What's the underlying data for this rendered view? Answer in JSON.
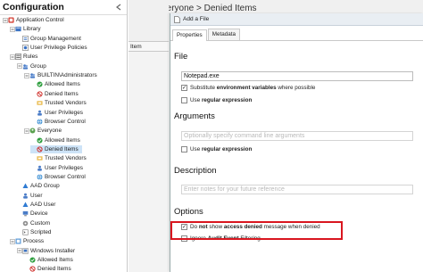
{
  "left_panel": {
    "title": "Configuration",
    "tree": [
      {
        "label": "Application Control",
        "icon": "appcontrol-icon",
        "indent": 0,
        "expander": "minus"
      },
      {
        "label": "Library",
        "icon": "library-icon",
        "indent": 1,
        "expander": "minus"
      },
      {
        "label": "Group Management",
        "icon": "group-mgmt-icon",
        "indent": 2,
        "expander": ""
      },
      {
        "label": "User Privilege Policies",
        "icon": "policy-icon",
        "indent": 2,
        "expander": ""
      },
      {
        "label": "Rules",
        "icon": "rules-icon",
        "indent": 1,
        "expander": "minus"
      },
      {
        "label": "Group",
        "icon": "group-icon",
        "indent": 2,
        "expander": "minus"
      },
      {
        "label": "BUILTIN\\Administrators",
        "icon": "users-icon",
        "indent": 3,
        "expander": "minus"
      },
      {
        "label": "Allowed Items",
        "icon": "allowed-icon",
        "indent": 4,
        "expander": ""
      },
      {
        "label": "Denied Items",
        "icon": "denied-icon",
        "indent": 4,
        "expander": ""
      },
      {
        "label": "Trusted Vendors",
        "icon": "vendor-icon",
        "indent": 4,
        "expander": ""
      },
      {
        "label": "User Privileges",
        "icon": "privileges-icon",
        "indent": 4,
        "expander": ""
      },
      {
        "label": "Browser Control",
        "icon": "browser-icon",
        "indent": 4,
        "expander": ""
      },
      {
        "label": "Everyone",
        "icon": "everyone-icon",
        "indent": 3,
        "expander": "minus"
      },
      {
        "label": "Allowed Items",
        "icon": "allowed-icon",
        "indent": 4,
        "expander": ""
      },
      {
        "label": "Denied Items",
        "icon": "denied-icon",
        "indent": 4,
        "expander": "",
        "selected": true
      },
      {
        "label": "Trusted Vendors",
        "icon": "vendor-icon",
        "indent": 4,
        "expander": ""
      },
      {
        "label": "User Privileges",
        "icon": "privileges-icon",
        "indent": 4,
        "expander": ""
      },
      {
        "label": "Browser Control",
        "icon": "browser-icon",
        "indent": 4,
        "expander": ""
      },
      {
        "label": "AAD Group",
        "icon": "aad-group-icon",
        "indent": 2,
        "expander": ""
      },
      {
        "label": "User",
        "icon": "user-icon",
        "indent": 2,
        "expander": ""
      },
      {
        "label": "AAD User",
        "icon": "aad-user-icon",
        "indent": 2,
        "expander": ""
      },
      {
        "label": "Device",
        "icon": "device-icon",
        "indent": 2,
        "expander": ""
      },
      {
        "label": "Custom",
        "icon": "custom-icon",
        "indent": 2,
        "expander": ""
      },
      {
        "label": "Scripted",
        "icon": "scripted-icon",
        "indent": 2,
        "expander": ""
      },
      {
        "label": "Process",
        "icon": "process-icon",
        "indent": 1,
        "expander": "minus"
      },
      {
        "label": "Windows Installer",
        "icon": "installer-icon",
        "indent": 2,
        "expander": "minus"
      },
      {
        "label": "Allowed Items",
        "icon": "allowed-icon",
        "indent": 3,
        "expander": ""
      },
      {
        "label": "Denied Items",
        "icon": "denied-icon",
        "indent": 3,
        "expander": ""
      }
    ]
  },
  "header": {
    "title": "Everyone > Denied Items"
  },
  "center": {
    "column_header": "Item"
  },
  "dialog": {
    "title": "Add a File",
    "tabs": [
      "Properties",
      "Metadata"
    ],
    "file": {
      "heading": "File",
      "value": "Notepad.exe",
      "substitute_label_pre": "Substitute ",
      "substitute_label_bold": "environment variables",
      "substitute_label_post": " where possible",
      "substitute_checked": true,
      "regex_label_pre": "Use ",
      "regex_label_bold": "regular expression",
      "regex_checked": false
    },
    "arguments": {
      "heading": "Arguments",
      "placeholder": "Optionally specify command line arguments",
      "regex_label_pre": "Use ",
      "regex_label_bold": "regular expression",
      "regex_checked": false
    },
    "description": {
      "heading": "Description",
      "placeholder": "Enter notes for your future reference"
    },
    "options": {
      "heading": "Options",
      "no_access_denied_pre": "Do ",
      "no_access_denied_bold1": "not",
      "no_access_denied_mid": " show ",
      "no_access_denied_bold2": "access denied",
      "no_access_denied_post": " message when denied",
      "no_access_denied_checked": true,
      "ignore_audit_pre": "Ignore ",
      "ignore_audit_bold": "Audit Event",
      "ignore_audit_post": " Filtering",
      "ignore_audit_checked": false
    }
  },
  "colors": {
    "highlight": "#d9161f",
    "selected_row": "#cde3f7",
    "denied_red": "#d0312d",
    "allowed_green": "#2e9e3e"
  }
}
